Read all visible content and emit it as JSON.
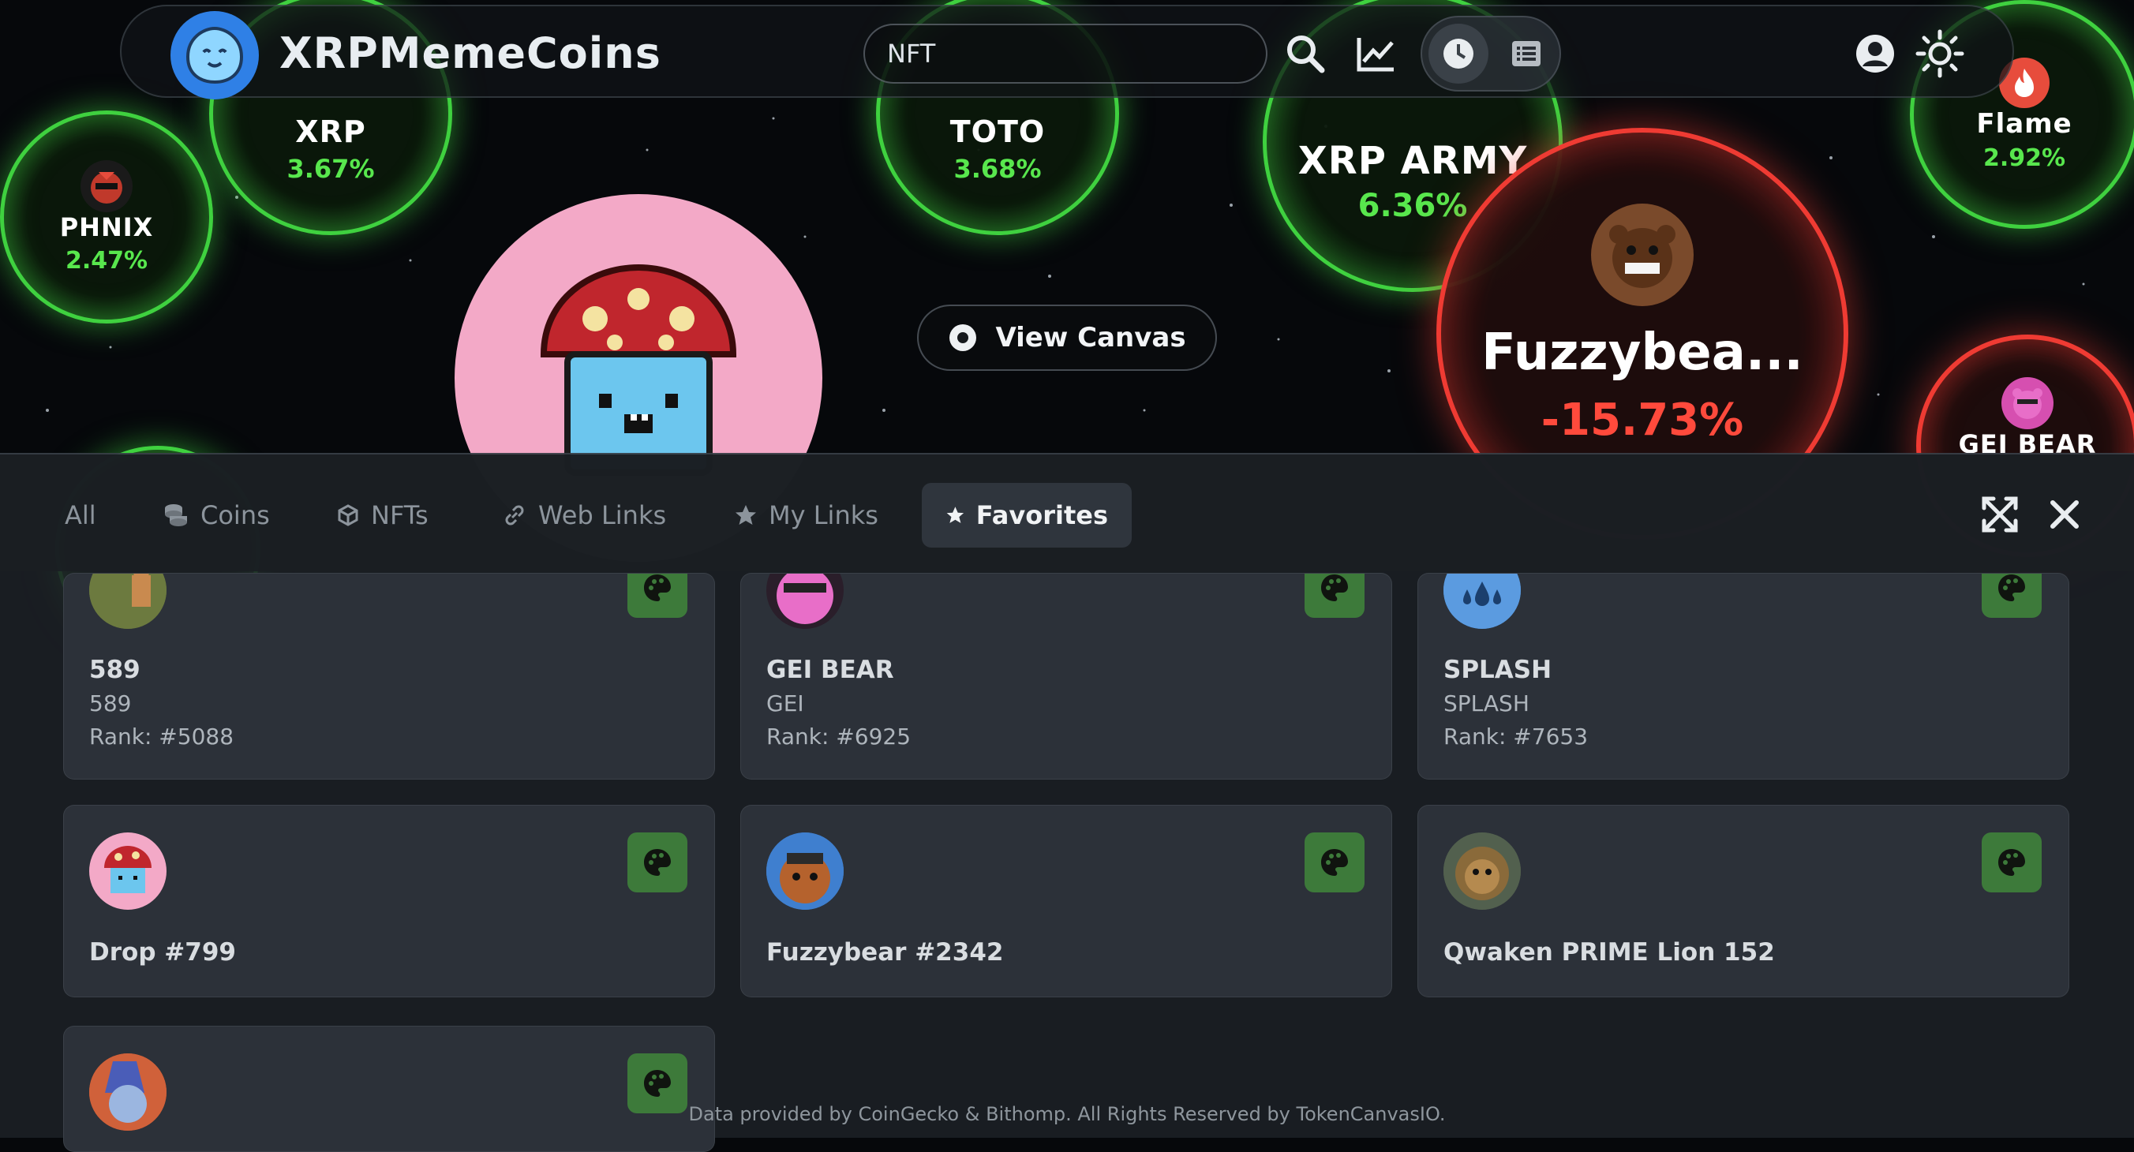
{
  "header": {
    "brand": "XRPMemeCoins",
    "search": {
      "value": "NFT",
      "placeholder": ""
    },
    "icons": [
      "search-icon",
      "chart-icon",
      "clock-icon",
      "list-icon",
      "user-icon",
      "sun-icon"
    ]
  },
  "canvas": {
    "view_canvas_label": "View Canvas",
    "bubbles": [
      {
        "name": "PHNIX",
        "change": "2.47%",
        "trend": "up"
      },
      {
        "name": "XRP",
        "change": "3.67%",
        "trend": "up"
      },
      {
        "name": "TOTO",
        "change": "3.68%",
        "trend": "up"
      },
      {
        "name": "XRP ARMY",
        "change": "6.36%",
        "trend": "up"
      },
      {
        "name": "Fuzzybea...",
        "change": "-15.73%",
        "trend": "down"
      },
      {
        "name": "Flame",
        "change": "2.92%",
        "trend": "up"
      },
      {
        "name": "GEI BEAR",
        "change": "",
        "trend": "down"
      }
    ]
  },
  "tabs": [
    {
      "label": "All",
      "icon": ""
    },
    {
      "label": "Coins",
      "icon": "coins-icon"
    },
    {
      "label": "NFTs",
      "icon": "cube-icon"
    },
    {
      "label": "Web Links",
      "icon": "link-icon"
    },
    {
      "label": "My Links",
      "icon": "star-icon"
    },
    {
      "label": "Favorites",
      "icon": "star-icon",
      "active": true
    }
  ],
  "cards": [
    {
      "title": "589",
      "symbol": "589",
      "rank": "Rank: #5088"
    },
    {
      "title": "GEI BEAR",
      "symbol": "GEI",
      "rank": "Rank: #6925"
    },
    {
      "title": "SPLASH",
      "symbol": "SPLASH",
      "rank": "Rank: #7653"
    },
    {
      "title": "Drop #799",
      "symbol": "",
      "rank": ""
    },
    {
      "title": "Fuzzybear #2342",
      "symbol": "",
      "rank": ""
    },
    {
      "title": "Qwaken PRIME Lion 152",
      "symbol": "",
      "rank": ""
    },
    {
      "title": "",
      "symbol": "",
      "rank": ""
    }
  ],
  "footer": "Data provided by CoinGecko & Bithomp. All Rights Reserved by TokenCanvasIO.",
  "colors": {
    "up": "#58e74d",
    "down": "#ff4a3c",
    "favorite_badge": "#3d7a3a",
    "brand_blue": "#2f80e6"
  }
}
